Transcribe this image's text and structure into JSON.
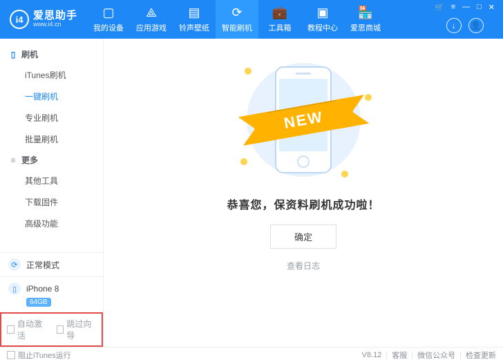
{
  "logo": {
    "mark": "i4",
    "title": "爱思助手",
    "subtitle": "www.i4.cn"
  },
  "nav": [
    {
      "label": "我的设备",
      "icon": "▢"
    },
    {
      "label": "应用游戏",
      "icon": "⟁"
    },
    {
      "label": "铃声壁纸",
      "icon": "▤"
    },
    {
      "label": "智能刷机",
      "icon": "⟳",
      "active": true
    },
    {
      "label": "工具箱",
      "icon": "💼"
    },
    {
      "label": "教程中心",
      "icon": "▣"
    },
    {
      "label": "爱思商城",
      "icon": "🏪"
    }
  ],
  "winctrl": {
    "cart": "🛒",
    "menu": "≡",
    "min": "—",
    "max": "□",
    "close": "✕"
  },
  "hr_icons": {
    "download": "↓",
    "user": "👤"
  },
  "sidebar": {
    "flash_title": "刷机",
    "flash_items": [
      "iTunes刷机",
      "一键刷机",
      "专业刷机",
      "批量刷机"
    ],
    "more_title": "更多",
    "more_items": [
      "其他工具",
      "下载固件",
      "高级功能"
    ],
    "mode": "正常模式",
    "device": "iPhone 8",
    "storage": "64GB",
    "cb_auto": "自动激活",
    "cb_skip": "跳过向导"
  },
  "main": {
    "ribbon": "NEW",
    "message": "恭喜您，保资料刷机成功啦！",
    "ok": "确定",
    "log": "查看日志"
  },
  "footer": {
    "prevent": "阻止iTunes运行",
    "version": "V8.12",
    "support": "客服",
    "wechat": "微信公众号",
    "update": "检查更新"
  }
}
